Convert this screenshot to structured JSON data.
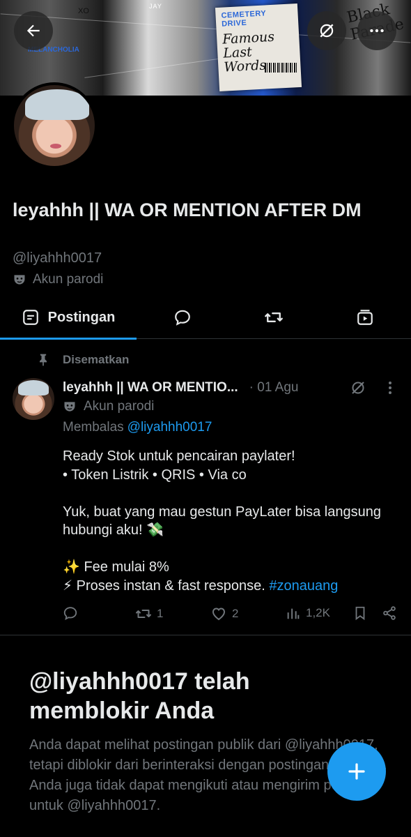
{
  "banner": {
    "card_title": "CEMETERY DRIVE",
    "card_script": "Famous Last Words",
    "tag_left": "MELANCHOLIA",
    "tag_jay": "JAY",
    "tag_xo": "XO",
    "tag_parade": "Black Parade"
  },
  "profile": {
    "name": "leyahhh || WA OR MENTION AFTER DM",
    "handle": "@liyahhh0017",
    "parody_label": "Akun parodi"
  },
  "tabs": [
    {
      "label": "Postingan",
      "icon": "posts-icon",
      "active": true
    },
    {
      "label": "",
      "icon": "replies-icon"
    },
    {
      "label": "",
      "icon": "reposts-icon"
    },
    {
      "label": "",
      "icon": "media-icon"
    }
  ],
  "pinned_label": "Disematkan",
  "post": {
    "author": "leyahhh || WA OR MENTIO...",
    "date": "· 01 Agu",
    "parody_label": "Akun parodi",
    "reply_prefix": "Membalas",
    "reply_mention": "@liyahhh0017",
    "line1": "Ready Stok untuk pencairan paylater!",
    "line2": "• Token Listrik  • QRIS  • Via co",
    "line3": "Yuk, buat yang mau gestun PayLater bisa langsung hubungi aku! 💸",
    "line4": "✨ Fee mulai 8%",
    "line5": "⚡ Proses instan & fast response.",
    "hashtag": "#zonauang",
    "retweets": "1",
    "likes": "2",
    "views": "1,2K"
  },
  "blocked": {
    "title": "@liyahhh0017 telah memblokir Anda",
    "text": "Anda dapat melihat postingan publik dari @liyahhh0017, tetapi diblokir dari berinteraksi dengan postingan tersebut. Anda juga tidak dapat mengikuti atau mengirim pesan untuk @liyahhh0017."
  },
  "colors": {
    "accent": "#1d9bf0",
    "muted": "#71767b",
    "text": "#e7e9ea",
    "background": "#000000"
  }
}
